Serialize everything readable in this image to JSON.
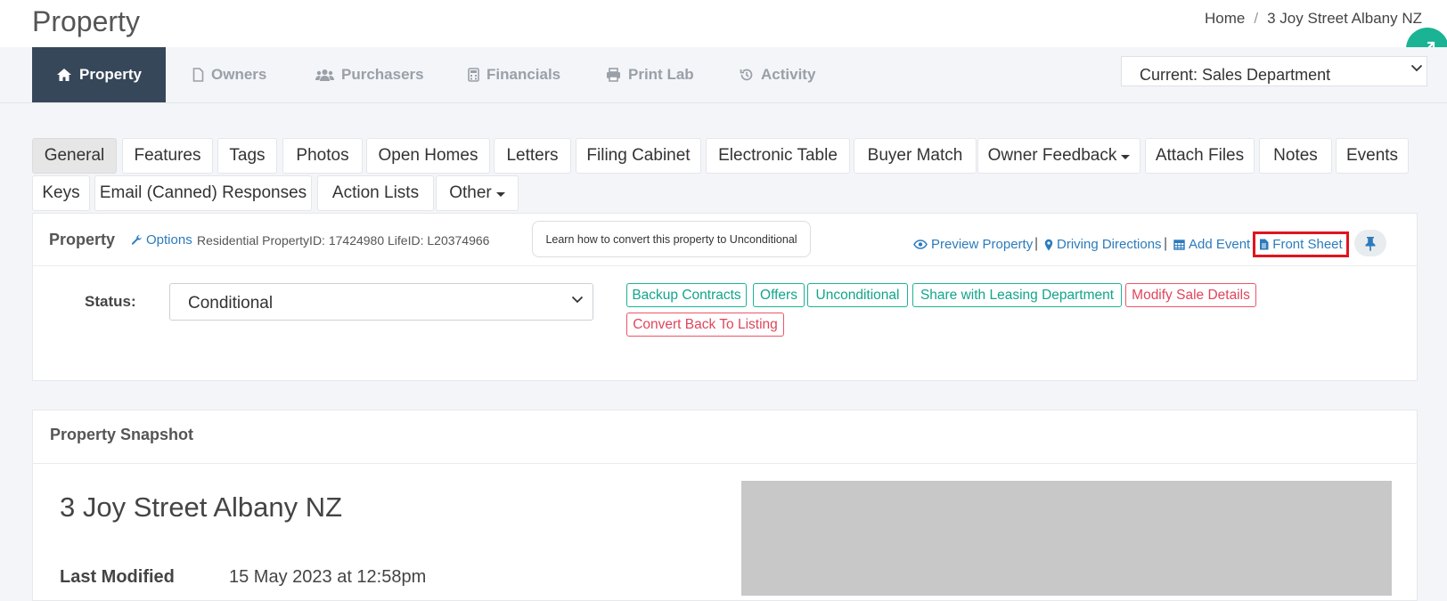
{
  "header": {
    "title": "Property",
    "breadcrumb": {
      "home": "Home",
      "separator": "/",
      "current": "3 Joy Street Albany NZ"
    }
  },
  "module_tabs": [
    {
      "label": "Property",
      "icon": "home-icon",
      "active": true
    },
    {
      "label": "Owners",
      "icon": "file-icon"
    },
    {
      "label": "Purchasers",
      "icon": "users-icon"
    },
    {
      "label": "Financials",
      "icon": "calculator-icon"
    },
    {
      "label": "Print Lab",
      "icon": "print-icon"
    },
    {
      "label": "Activity",
      "icon": "history-icon"
    }
  ],
  "department_select": {
    "value": "Current: Sales Department"
  },
  "sub_tabs": [
    {
      "label": "General",
      "active": true
    },
    {
      "label": "Features"
    },
    {
      "label": "Tags"
    },
    {
      "label": "Photos"
    },
    {
      "label": "Open Homes"
    },
    {
      "label": "Letters"
    },
    {
      "label": "Filing Cabinet"
    },
    {
      "label": "Electronic Table"
    },
    {
      "label": "Buyer Match"
    },
    {
      "label": "Owner Feedback",
      "dropdown": true
    },
    {
      "label": "Attach Files"
    },
    {
      "label": "Notes"
    },
    {
      "label": "Events"
    },
    {
      "label": "Keys"
    },
    {
      "label": "Email (Canned) Responses"
    },
    {
      "label": "Action Lists"
    },
    {
      "label": "Other",
      "dropdown": true
    }
  ],
  "property_panel": {
    "title": "Property",
    "options_link": "Options",
    "meta": "Residential PropertyID: 17424980 LifeID: L20374966",
    "help_button": "Learn how to convert this property to Unconditional",
    "links": {
      "preview": "Preview Property",
      "directions": "Driving Directions",
      "add_event": "Add Event",
      "front_sheet": "Front Sheet"
    },
    "separator": "|",
    "status_label": "Status:",
    "status_value": "Conditional",
    "actions": {
      "backup_contracts": "Backup Contracts",
      "offers": "Offers",
      "unconditional": "Unconditional",
      "share_leasing": "Share with Leasing Department",
      "modify_sale": "Modify Sale Details",
      "convert_back": "Convert Back To Listing"
    }
  },
  "snapshot": {
    "title": "Property Snapshot",
    "address": "3 Joy Street Albany NZ",
    "last_modified_label": "Last Modified",
    "last_modified_value": "15 May 2023 at 12:58pm"
  },
  "colors": {
    "accent_green": "#1ab394",
    "danger_red": "#ed5565",
    "link_blue": "#2b7bbd",
    "nav_active": "#37475a",
    "highlight_box": "#e0141e"
  }
}
